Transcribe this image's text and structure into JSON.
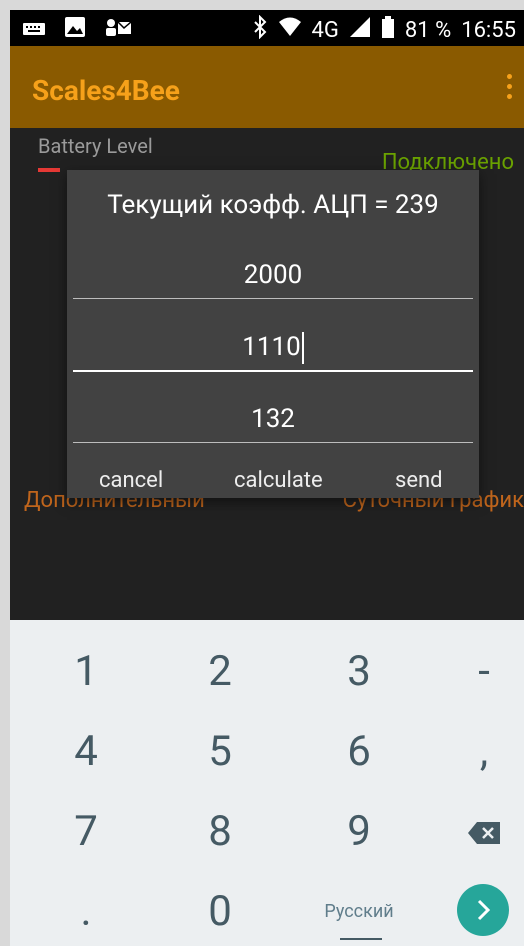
{
  "statusbar": {
    "network": "4G",
    "battery_percent": "81 %",
    "time": "16:55"
  },
  "app": {
    "title": "Scales4Bee"
  },
  "main": {
    "battery_label": "Battery Level",
    "connection_status": "Подключено",
    "link_left": "Дополнительный",
    "link_right": "Суточный график"
  },
  "dialog": {
    "title": "Текущий коэфф. АЦП = 239",
    "fields": [
      "2000",
      "1110",
      "132"
    ],
    "buttons": {
      "cancel": "cancel",
      "calculate": "calculate",
      "send": "send"
    }
  },
  "keyboard": {
    "rows": [
      [
        "1",
        "2",
        "3",
        "-"
      ],
      [
        "4",
        "5",
        "6",
        ","
      ],
      [
        "7",
        "8",
        "9",
        "backspace"
      ],
      [
        ".",
        "0",
        "Русский",
        "go"
      ]
    ],
    "accent": "#26a69a"
  },
  "colors": {
    "appbar": "#8a5a00",
    "title": "#f6a11a",
    "connected": "#6aa200",
    "links": "#c0651c"
  }
}
